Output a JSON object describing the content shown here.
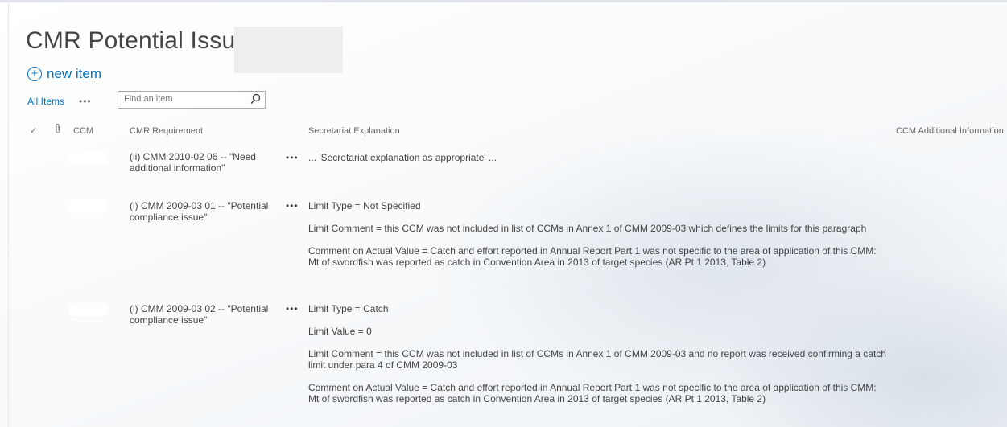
{
  "page": {
    "title": "CMR Potential Issues"
  },
  "toolbar": {
    "new_item_icon": "+",
    "new_item_label": "new item"
  },
  "views": {
    "all_items": "All Items",
    "more": "•••"
  },
  "search": {
    "placeholder": "Find an item"
  },
  "columns": {
    "check": "✓",
    "ccm": "CCM",
    "requirement": "CMR Requirement",
    "explanation": "Secretariat Explanation",
    "additional": "CCM Additional Information"
  },
  "rows": [
    {
      "requirement": "(ii) CMM 2010-02 06 -- \"Need additional information\"",
      "menu": "•••",
      "explanation": [
        "... 'Secretariat explanation as appropriate' ..."
      ]
    },
    {
      "requirement": "(i) CMM 2009-03 01 -- \"Potential compliance issue\"",
      "menu": "•••",
      "explanation": [
        "Limit Type = Not Specified",
        "Limit Comment = this CCM was not included in list of CCMs in Annex 1 of CMM 2009-03 which defines the limits for this paragraph",
        "Comment on Actual Value = Catch and effort reported in Annual Report Part 1 was not specific to the area of application of this CMM:      Mt of swordfish was reported as catch in Convention Area in 2013 of target species (AR Pt 1 2013, Table 2)"
      ]
    },
    {
      "requirement": "(i) CMM 2009-03 02 -- \"Potential compliance issue\"",
      "menu": "•••",
      "explanation": [
        "Limit Type = Catch",
        "Limit Value = 0",
        "Limit Comment = this CCM was not included in list of CCMs in Annex 1 of CMM 2009-03 and no report was received confirming a catch limit under para 4 of CMM 2009-03",
        "Comment on Actual Value = Catch and effort reported in Annual Report Part 1 was not specific to the area of application of this CMM:      Mt of swordfish was reported as catch in Convention Area in 2013 of target species (AR Pt 1 2013, Table 2)"
      ]
    }
  ],
  "colors": {
    "link": "#0072c6",
    "text": "#444444",
    "header_text": "#666666"
  }
}
